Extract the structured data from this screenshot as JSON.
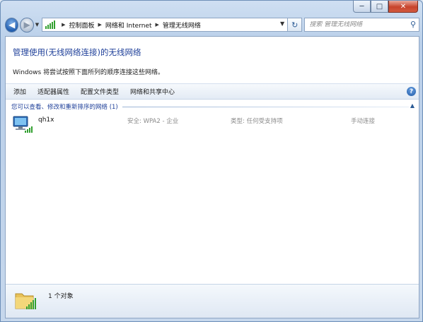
{
  "window": {
    "caption": {
      "minimize": "─",
      "maximize": "□",
      "close": "✕"
    }
  },
  "nav": {
    "back_icon": "back-arrow-icon",
    "forward_icon": "forward-arrow-icon",
    "breadcrumb": [
      "控制面板",
      "网络和 Internet",
      "管理无线网络"
    ],
    "search_placeholder": "搜索 管理无线网络"
  },
  "header": {
    "title": "管理使用(无线网络连接)的无线网络",
    "description": "Windows 将尝试按照下面所列的顺序连接这些网络。"
  },
  "toolbar": {
    "items": [
      "添加",
      "适配器属性",
      "配置文件类型",
      "网络和共享中心"
    ],
    "help": "?"
  },
  "group": {
    "title": "您可以查看、修改和重新排序的网络 (1)"
  },
  "networks": [
    {
      "name": "qh1x",
      "security": "安全: WPA2 - 企业",
      "type": "类型: 任何受支持项",
      "connect": "手动连接"
    }
  ],
  "status": {
    "text": "1 个对象"
  },
  "colors": {
    "link_blue": "#1e3f99",
    "signal_green": "#32a030"
  }
}
